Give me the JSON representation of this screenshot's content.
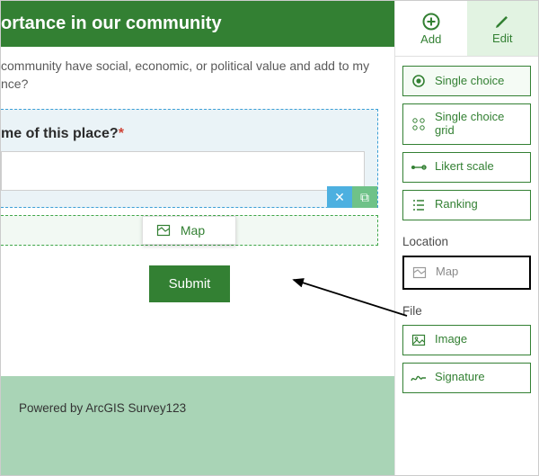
{
  "header": {
    "title": "ortance in our community"
  },
  "subtitle": {
    "line1": "community have social, economic, or political value and add to my",
    "line2": "nce?"
  },
  "question": {
    "label": "me of this place?",
    "required_marker": "*",
    "value": ""
  },
  "drop": {
    "label": "Map"
  },
  "submit": {
    "label": "Submit"
  },
  "footer": {
    "text": "Powered by ArcGIS Survey123"
  },
  "tabs": {
    "add": "Add",
    "edit": "Edit"
  },
  "options": {
    "single_choice": "Single choice",
    "single_choice_grid": "Single choice grid",
    "likert": "Likert scale",
    "ranking": "Ranking",
    "location_header": "Location",
    "map": "Map",
    "file_header": "File",
    "image": "Image",
    "signature": "Signature"
  },
  "icons": {
    "close": "✕",
    "copy": "⧉"
  }
}
